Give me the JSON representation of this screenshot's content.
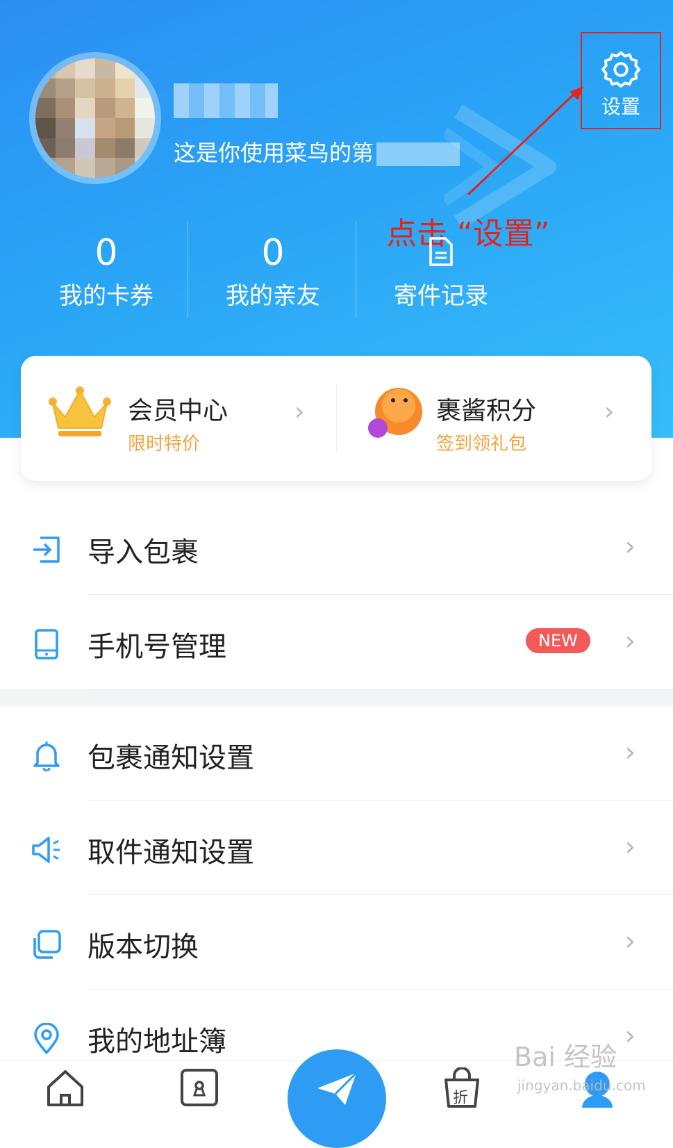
{
  "header": {
    "subtitle": "这是你使用菜鸟的第",
    "settings_label": "设置",
    "annotation": "点击 “设置”"
  },
  "stats": [
    {
      "value": "0",
      "label": "我的卡券"
    },
    {
      "value": "0",
      "label": "我的亲友"
    },
    {
      "value": "",
      "label": "寄件记录",
      "icon": "document-icon"
    }
  ],
  "promo": [
    {
      "title": "会员中心",
      "subtitle": "限时特价",
      "icon": "crown-icon"
    },
    {
      "title": "裹酱积分",
      "subtitle": "签到领礼包",
      "icon": "mascot-icon"
    }
  ],
  "menu": [
    {
      "label": "导入包裹",
      "icon": "import-icon"
    },
    {
      "label": "手机号管理",
      "icon": "phone-icon",
      "badge": "NEW"
    },
    {
      "label": "包裹通知设置",
      "icon": "bell-icon"
    },
    {
      "label": "取件通知设置",
      "icon": "speaker-icon"
    },
    {
      "label": "版本切换",
      "icon": "switch-icon"
    },
    {
      "label": "我的地址簿",
      "icon": "location-pin-icon"
    }
  ],
  "bottom_nav": [
    {
      "icon": "home-icon"
    },
    {
      "icon": "package-icon"
    },
    {
      "icon": "send-icon"
    },
    {
      "icon": "shopping-bag-icon",
      "label": "折"
    },
    {
      "icon": "profile-icon"
    }
  ],
  "watermark": {
    "main": "Bai 经验",
    "sub": "jingyan.baidu.com"
  },
  "colors": {
    "brand": "#2b9af3",
    "accent_red": "#e5231b",
    "promo_orange": "#f5a23a",
    "badge_red": "#f25a5a"
  }
}
